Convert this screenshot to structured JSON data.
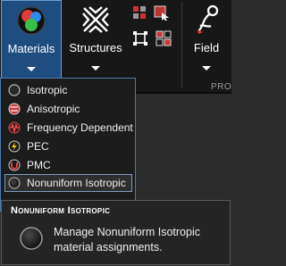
{
  "ribbon": {
    "materials_label": "Materials",
    "structures_label": "Structures",
    "field_label": "Field",
    "group_label_partial": "PRO"
  },
  "menu": {
    "items": [
      {
        "label": "Isotropic",
        "icon": "isotropic-icon"
      },
      {
        "label": "Anisotropic",
        "icon": "anisotropic-icon"
      },
      {
        "label": "Frequency Dependent",
        "icon": "frequency-dependent-icon"
      },
      {
        "label": "PEC",
        "icon": "pec-icon"
      },
      {
        "label": "PMC",
        "icon": "pmc-icon"
      },
      {
        "label": "Nonuniform Isotropic",
        "icon": "nonuniform-isotropic-icon"
      }
    ]
  },
  "tooltip": {
    "title": "Nonuniform Isotropic",
    "description": "Manage Nonuniform Isotropic material assignments."
  },
  "colors": {
    "ribbon_bg": "#171717",
    "active_button": "#1f4d80",
    "menu_border": "#4a7ab0"
  }
}
